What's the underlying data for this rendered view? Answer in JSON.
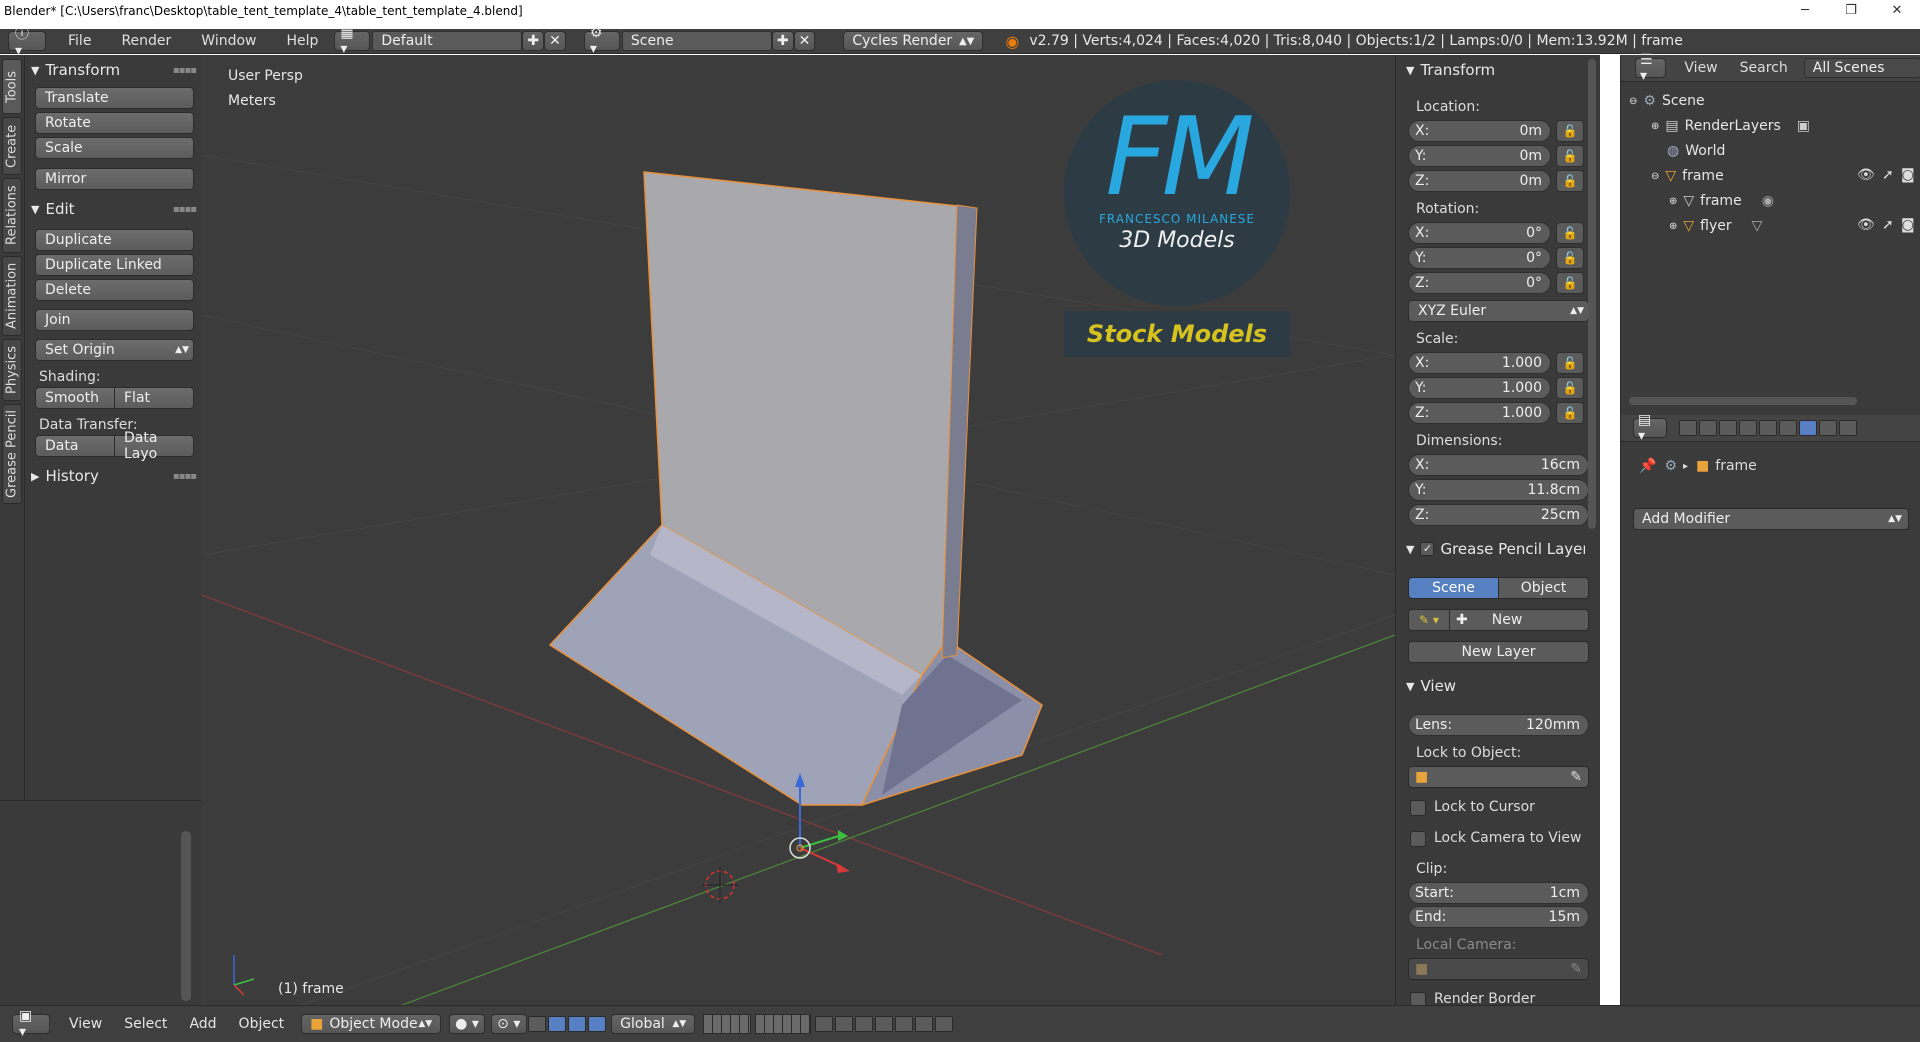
{
  "window": {
    "title": "Blender* [C:\\Users\\franc\\Desktop\\table_tent_template_4\\table_tent_template_4.blend]",
    "controls": [
      "─",
      "❐",
      "✕"
    ]
  },
  "topbar": {
    "menus": [
      "File",
      "Render",
      "Window",
      "Help"
    ],
    "layout": "Default",
    "scene": "Scene",
    "engine": "Cycles Render",
    "stats": "v2.79 | Verts:4,024 | Faces:4,020 | Tris:8,040 | Objects:1/2 | Lamps:0/0 | Mem:13.92M | frame"
  },
  "tool_tabs": [
    "Tools",
    "Create",
    "Relations",
    "Animation",
    "Physics",
    "Grease Pencil"
  ],
  "tools": {
    "transform_title": "Transform",
    "transform_buttons": [
      "Translate",
      "Rotate",
      "Scale"
    ],
    "mirror": "Mirror",
    "edit_title": "Edit",
    "edit_buttons": [
      "Duplicate",
      "Duplicate Linked",
      "Delete"
    ],
    "join": "Join",
    "set_origin": "Set Origin",
    "shading_label": "Shading:",
    "smooth": "Smooth",
    "flat": "Flat",
    "data_transfer_label": "Data Transfer:",
    "data": "Data",
    "data_layo": "Data Layo",
    "history": "History"
  },
  "viewport": {
    "view_name": "User Persp",
    "units": "Meters",
    "object_label": "(1) frame",
    "logo": {
      "letters": "FM",
      "name": "FRANCESCO MILANESE",
      "sub": "3D Models",
      "banner": "Stock Models"
    }
  },
  "properties": {
    "transform_title": "Transform",
    "location_label": "Location:",
    "location": [
      "0m",
      "0m",
      "0m"
    ],
    "rotation_label": "Rotation:",
    "rotation": [
      "0°",
      "0°",
      "0°"
    ],
    "rotation_mode": "XYZ Euler",
    "scale_label": "Scale:",
    "scale": [
      "1.000",
      "1.000",
      "1.000"
    ],
    "dimensions_label": "Dimensions:",
    "dimensions": [
      "16cm",
      "11.8cm",
      "25cm"
    ],
    "axis": [
      "X:",
      "Y:",
      "Z:"
    ],
    "grease_title": "Grease Pencil Layer",
    "scene_tab": "Scene",
    "object_tab": "Object",
    "new": "New",
    "new_layer": "New Layer",
    "view_title": "View",
    "lens_label": "Lens:",
    "lens": "120mm",
    "lock_object_label": "Lock to Object:",
    "lock_cursor": "Lock to Cursor",
    "lock_camera": "Lock Camera to View",
    "clip_label": "Clip:",
    "clip_start_label": "Start:",
    "clip_start": "1cm",
    "clip_end_label": "End:",
    "clip_end": "15m",
    "local_camera_label": "Local Camera:",
    "render_border": "Render Border"
  },
  "outliner": {
    "menus": [
      "View",
      "Search"
    ],
    "filter": "All Scenes",
    "rows": [
      "Scene",
      "RenderLayers",
      "World",
      "frame",
      "frame",
      "flyer"
    ]
  },
  "modifiers": {
    "breadcrumb": "frame",
    "add_modifier": "Add Modifier"
  },
  "bottombar": {
    "menus": [
      "View",
      "Select",
      "Add",
      "Object"
    ],
    "mode": "Object Mode",
    "orientation": "Global"
  },
  "colors": {
    "accent": "#5680c2",
    "selection_outline": "#e8903a",
    "panel": "#3a3a3a",
    "viewport": "#3c3c3c"
  }
}
